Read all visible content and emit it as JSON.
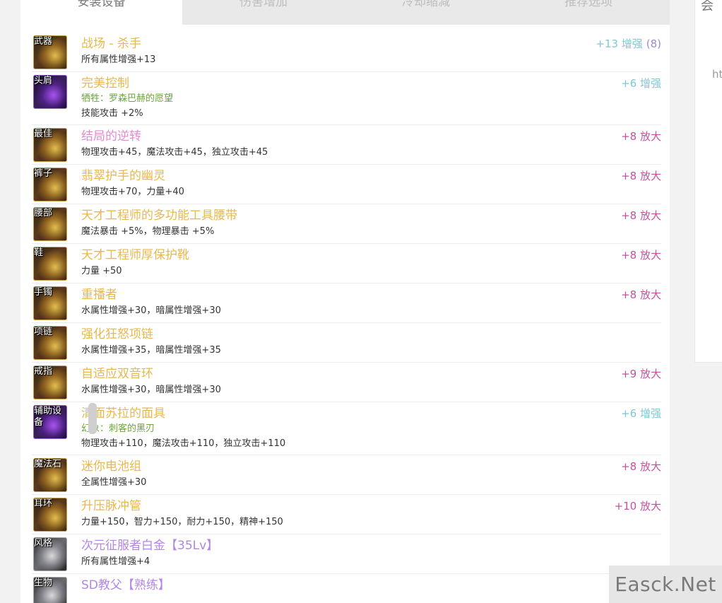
{
  "tabs": [
    "安装设备",
    "伤害增加",
    "冷却缩减",
    "推荐选项"
  ],
  "side": {
    "top_char": "会",
    "text": "ht"
  },
  "watermark": "Easck.Net",
  "items": [
    {
      "slot": "武器",
      "name": "战场 - 杀手",
      "subs": [],
      "stats": [
        "所有属性增强+13"
      ],
      "tag": "+13 增强",
      "tag_extra": "(8)",
      "tag_color": "cyan",
      "icon": "gold",
      "name_color": "gold"
    },
    {
      "slot": "头肩",
      "name": "完美控制",
      "subs": [
        "牺牲：罗森巴赫的愿望"
      ],
      "stats": [
        "技能攻击 +2%"
      ],
      "tag": "+6 增强",
      "tag_extra": "",
      "tag_color": "cyan",
      "icon": "purple",
      "name_color": "gold"
    },
    {
      "slot": "最佳",
      "name": "结局的逆转",
      "subs": [],
      "stats": [
        "物理攻击+45，魔法攻击+45，独立攻击+45"
      ],
      "tag": "+8 放大",
      "tag_extra": "",
      "tag_color": "pink",
      "icon": "gold",
      "name_color": "pink"
    },
    {
      "slot": "裤子",
      "name": "翡翠护手的幽灵",
      "subs": [],
      "stats": [
        "物理攻击+70，力量+40"
      ],
      "tag": "+8 放大",
      "tag_extra": "",
      "tag_color": "pink",
      "icon": "gold",
      "name_color": "gold"
    },
    {
      "slot": "腰部",
      "name": "天才工程师的多功能工具腰带",
      "subs": [],
      "stats": [
        "魔法暴击 +5%，物理暴击 +5%"
      ],
      "tag": "+8 放大",
      "tag_extra": "",
      "tag_color": "pink",
      "icon": "gold",
      "name_color": "gold"
    },
    {
      "slot": "鞋",
      "name": "天才工程师厚保护靴",
      "subs": [],
      "stats": [
        "力量 +50"
      ],
      "tag": "+8 放大",
      "tag_extra": "",
      "tag_color": "pink",
      "icon": "gold",
      "name_color": "gold"
    },
    {
      "slot": "手镯",
      "name": "重播者",
      "subs": [],
      "stats": [
        "水属性增强+30，暗属性增强+30"
      ],
      "tag": "+8 放大",
      "tag_extra": "",
      "tag_color": "pink",
      "icon": "gold",
      "name_color": "gold"
    },
    {
      "slot": "项链",
      "name": "强化狂怒项链",
      "subs": [],
      "stats": [
        "水属性增强+35，暗属性增强+35"
      ],
      "tag": "",
      "tag_extra": "",
      "tag_color": "pink",
      "icon": "gold",
      "name_color": "gold"
    },
    {
      "slot": "戒指",
      "name": "自适应双音环",
      "subs": [],
      "stats": [
        "水属性增强+30，暗属性增强+30"
      ],
      "tag": "+9 放大",
      "tag_extra": "",
      "tag_color": "pink",
      "icon": "gold",
      "name_color": "gold"
    },
    {
      "slot": "辅助设备",
      "name": "清面苏拉的面具",
      "subs": [
        "幻象：刺客的黑刃"
      ],
      "stats": [
        "物理攻击+110，魔法攻击+110，独立攻击+110"
      ],
      "tag": "+6 增强",
      "tag_extra": "",
      "tag_color": "cyan",
      "icon": "purple",
      "name_color": "gold"
    },
    {
      "slot": "魔法石",
      "name": "迷你电池组",
      "subs": [],
      "stats": [
        "全属性增强+30"
      ],
      "tag": "+8 放大",
      "tag_extra": "",
      "tag_color": "pink",
      "icon": "gold",
      "name_color": "gold"
    },
    {
      "slot": "耳环",
      "name": "升压脉冲管",
      "subs": [],
      "stats": [
        "力量+150，智力+150，耐力+150，精神+150"
      ],
      "tag": "+10 放大",
      "tag_extra": "",
      "tag_color": "pink",
      "icon": "gold",
      "name_color": "gold"
    },
    {
      "slot": "风格",
      "name": "次元征服者白金【35Lv】",
      "subs": [],
      "stats": [
        "所有属性增强+4"
      ],
      "tag": "",
      "tag_extra": "",
      "tag_color": "pink",
      "icon": "silver",
      "name_color": "purple"
    },
    {
      "slot": "生物",
      "name": "SD教父【熟练】",
      "subs": [],
      "stats": [],
      "tag": "",
      "tag_extra": "",
      "tag_color": "pink",
      "icon": "silver",
      "name_color": "purple"
    }
  ]
}
